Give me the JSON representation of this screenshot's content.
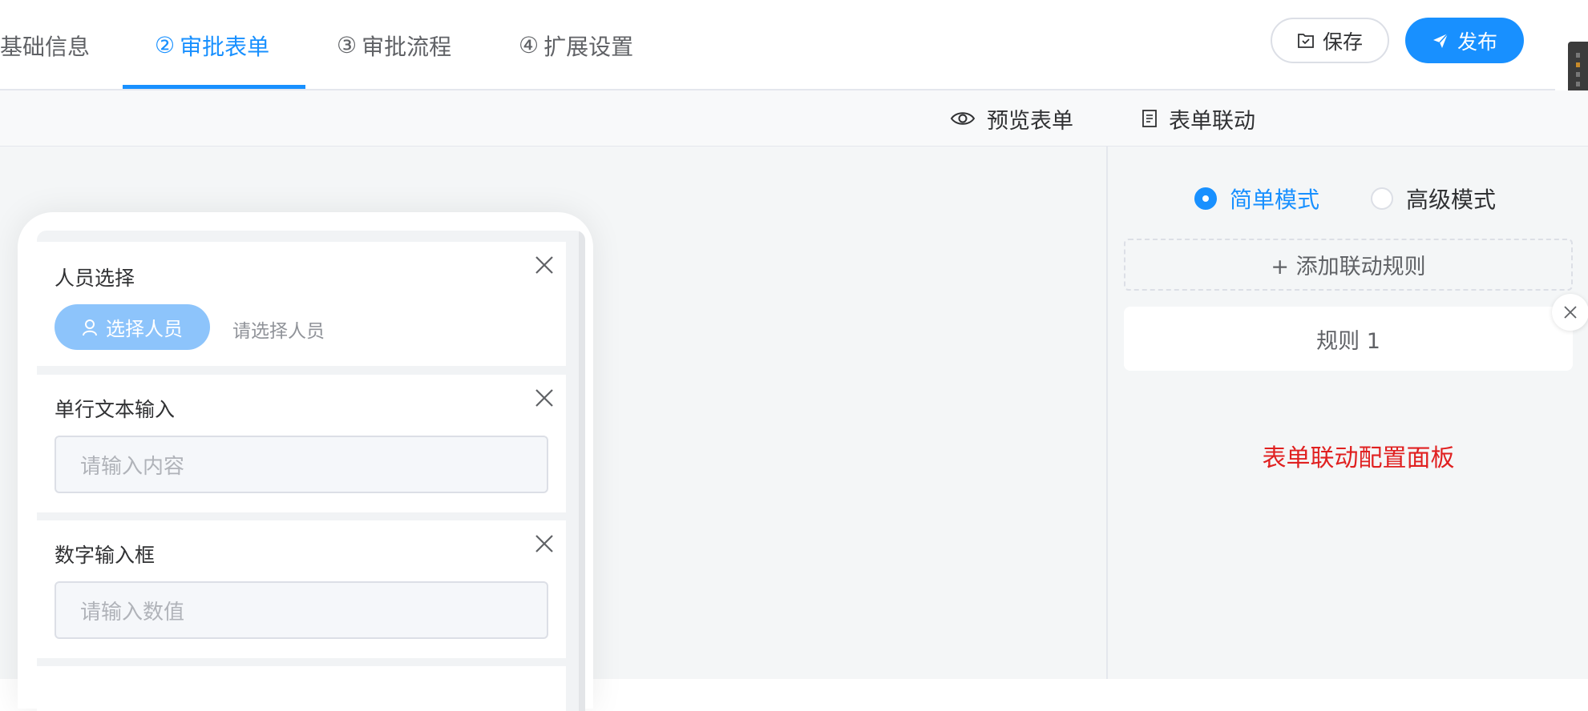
{
  "tabs": [
    {
      "prefix": "",
      "label": "基础信息"
    },
    {
      "prefix": "②",
      "label": "审批表单"
    },
    {
      "prefix": "③",
      "label": "审批流程"
    },
    {
      "prefix": "④",
      "label": "扩展设置"
    }
  ],
  "actions": {
    "save_label": "保存",
    "publish_label": "发布"
  },
  "toolbar": {
    "preview_label": "预览表单",
    "linkage_label": "表单联动"
  },
  "form_fields": [
    {
      "label": "人员选择",
      "button_label": "选择人员",
      "hint": "请选择人员"
    },
    {
      "label": "单行文本输入",
      "placeholder": "请输入内容"
    },
    {
      "label": "数字输入框",
      "placeholder": "请输入数值"
    }
  ],
  "linkage_panel": {
    "modes": [
      {
        "label": "简单模式",
        "checked": true
      },
      {
        "label": "高级模式",
        "checked": false
      }
    ],
    "add_rule_label": "+ 添加联动规则",
    "rules": [
      {
        "label": "规则 1"
      }
    ],
    "title": "表单联动配置面板"
  },
  "colors": {
    "primary": "#1890ff",
    "accent_red": "#e02020",
    "pick_button": "#8dc4fb"
  },
  "icons": {
    "save": "save-icon",
    "publish": "paper-plane-icon",
    "preview": "eye-icon",
    "linkage": "document-icon",
    "person": "person-icon",
    "close": "close-icon"
  }
}
